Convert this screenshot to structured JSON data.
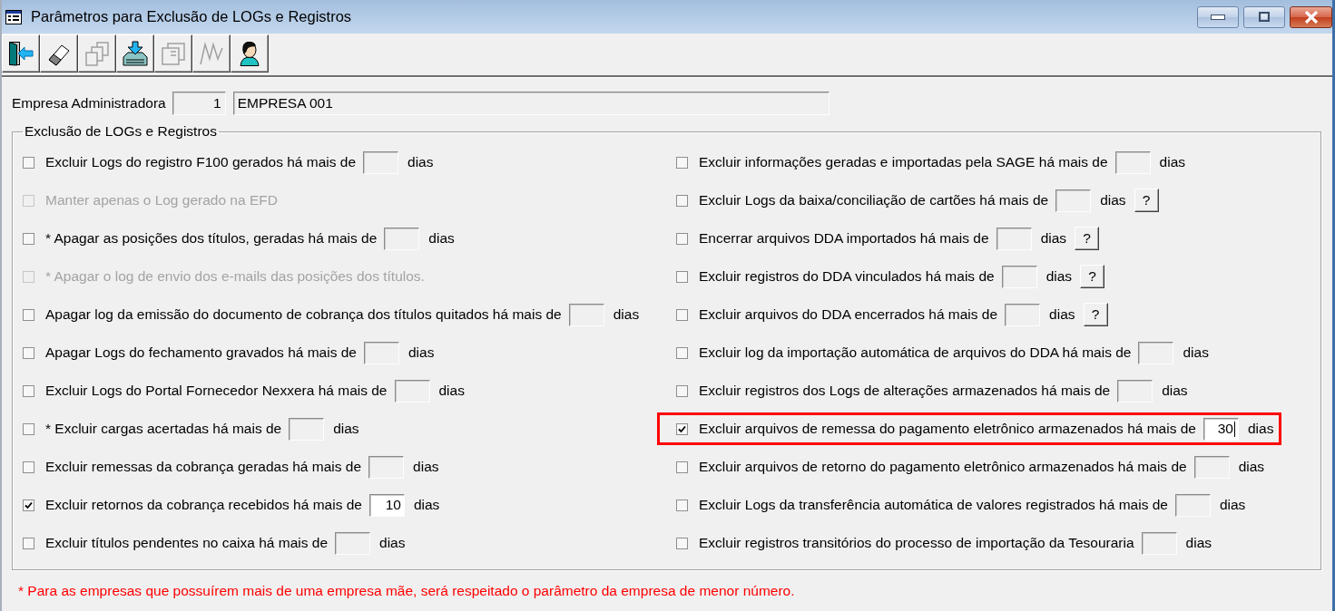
{
  "window": {
    "title": "Parâmetros para Exclusão de LOGs e Registros"
  },
  "toolbar": [
    {
      "kind": "door",
      "disabled": false
    },
    {
      "kind": "eraser",
      "disabled": false
    },
    {
      "kind": "pages",
      "disabled": true
    },
    {
      "kind": "tray",
      "disabled": false
    },
    {
      "kind": "sheet",
      "disabled": true
    },
    {
      "kind": "peaks",
      "disabled": true
    },
    {
      "kind": "person",
      "disabled": false
    }
  ],
  "company": {
    "label": "Empresa Administradora",
    "code": "1",
    "name": "EMPRESA 001"
  },
  "group": {
    "title": "Exclusão de LOGs e Registros",
    "left": [
      {
        "kind": "days",
        "label": "Excluir Logs do registro F100 gerados há mais de",
        "checked": false,
        "disabled": false,
        "highlighted": false,
        "field": {
          "focused": false
        },
        "unit": "dias"
      },
      {
        "kind": "plain",
        "label": "Manter apenas o Log gerado na EFD",
        "checked": false,
        "disabled": true,
        "highlighted": false
      },
      {
        "kind": "days",
        "label": "* Apagar as posições dos títulos, geradas há mais de",
        "checked": false,
        "disabled": false,
        "highlighted": false,
        "field": {
          "focused": false
        },
        "unit": "dias"
      },
      {
        "kind": "plain",
        "label": "* Apagar o log de envio dos e-mails das posições dos títulos.",
        "checked": false,
        "disabled": true,
        "highlighted": false
      },
      {
        "kind": "days",
        "label": "Apagar log da emissão do documento de cobrança dos títulos quitados há mais de",
        "checked": false,
        "disabled": false,
        "highlighted": false,
        "field": {
          "focused": false
        },
        "unit": "dias"
      },
      {
        "kind": "days",
        "label": "Apagar Logs do fechamento gravados há mais de",
        "checked": false,
        "disabled": false,
        "highlighted": false,
        "field": {
          "focused": false
        },
        "unit": "dias"
      },
      {
        "kind": "days",
        "label": "Excluir Logs do Portal Fornecedor Nexxera há mais de",
        "checked": false,
        "disabled": false,
        "highlighted": false,
        "field": {
          "focused": false
        },
        "unit": "dias"
      },
      {
        "kind": "days",
        "label": "* Excluir cargas acertadas há mais de",
        "checked": false,
        "disabled": false,
        "highlighted": false,
        "field": {
          "focused": false
        },
        "unit": "dias"
      },
      {
        "kind": "days",
        "label": "Excluir remessas da cobrança geradas há mais de",
        "checked": false,
        "disabled": false,
        "highlighted": false,
        "field": {
          "focused": false
        },
        "unit": "dias"
      },
      {
        "kind": "days",
        "label": "Excluir retornos da cobrança recebidos há mais de",
        "checked": true,
        "disabled": false,
        "highlighted": false,
        "field": {
          "value": "10",
          "focused": false
        },
        "unit": "dias"
      },
      {
        "kind": "days",
        "label": "Excluir títulos pendentes no caixa há mais de",
        "checked": false,
        "disabled": false,
        "highlighted": false,
        "field": {
          "focused": false
        },
        "unit": "dias"
      }
    ],
    "right": [
      {
        "kind": "days",
        "label": "Excluir informações geradas e importadas pela SAGE há mais de",
        "checked": false,
        "disabled": false,
        "highlighted": false,
        "field": {
          "focused": false
        },
        "unit": "dias"
      },
      {
        "kind": "days",
        "label": "Excluir Logs da baixa/conciliação de cartões há mais de",
        "checked": false,
        "disabled": false,
        "highlighted": false,
        "field": {
          "focused": false
        },
        "unit": "dias",
        "help": "?"
      },
      {
        "kind": "days",
        "label": "Encerrar arquivos DDA importados há mais de",
        "checked": false,
        "disabled": false,
        "highlighted": false,
        "field": {
          "focused": false
        },
        "unit": "dias",
        "help": "?"
      },
      {
        "kind": "days",
        "label": "Excluir registros do DDA vinculados há mais de",
        "checked": false,
        "disabled": false,
        "highlighted": false,
        "field": {
          "focused": false
        },
        "unit": "dias",
        "help": "?"
      },
      {
        "kind": "days",
        "label": "Excluir arquivos do DDA encerrados há mais de",
        "checked": false,
        "disabled": false,
        "highlighted": false,
        "field": {
          "focused": false
        },
        "unit": "dias",
        "help": "?"
      },
      {
        "kind": "days",
        "label": "Excluir log da importação automática de arquivos do DDA há mais de",
        "checked": false,
        "disabled": false,
        "highlighted": false,
        "field": {
          "focused": false
        },
        "unit": "dias"
      },
      {
        "kind": "days",
        "label": "Excluir registros dos Logs de alterações armazenados há mais de",
        "checked": false,
        "disabled": false,
        "highlighted": false,
        "field": {
          "focused": false
        },
        "unit": "dias"
      },
      {
        "kind": "days",
        "label": "Excluir arquivos de remessa do pagamento eletrônico armazenados há mais de",
        "checked": true,
        "disabled": false,
        "highlighted": true,
        "field": {
          "value": "30",
          "focused": true
        },
        "unit": "dias"
      },
      {
        "kind": "days",
        "label": "Excluir arquivos de retorno do pagamento eletrônico armazenados há mais de",
        "checked": false,
        "disabled": false,
        "highlighted": false,
        "field": {
          "focused": false
        },
        "unit": "dias"
      },
      {
        "kind": "days",
        "label": "Excluir Logs da transferência automática de valores registrados há mais de",
        "checked": false,
        "disabled": false,
        "highlighted": false,
        "field": {
          "focused": false
        },
        "unit": "dias"
      },
      {
        "kind": "days",
        "label": "Excluir registros transitórios do processo de importação da Tesouraria",
        "checked": false,
        "disabled": false,
        "highlighted": false,
        "field": {
          "focused": false
        },
        "unit": "dias"
      }
    ]
  },
  "note": "* Para as empresas que possuírem mais de uma empresa mãe, será respeitado o parâmetro da empresa de menor número."
}
